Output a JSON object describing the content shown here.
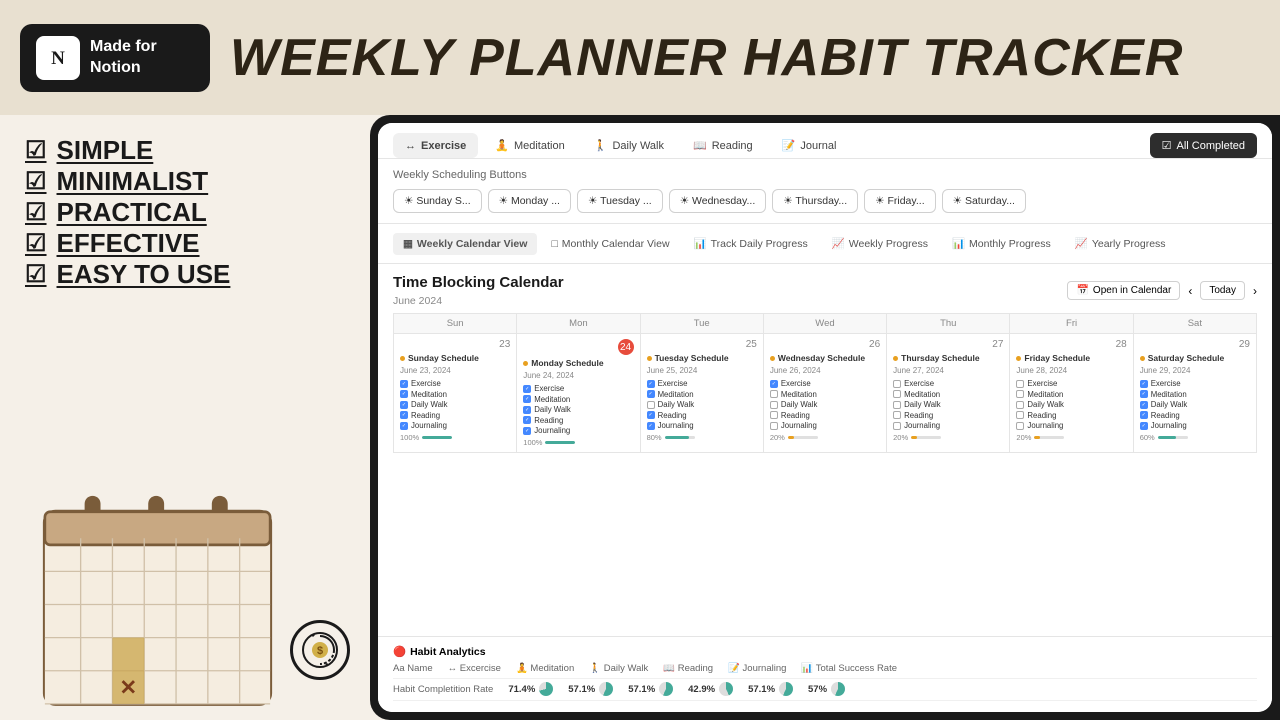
{
  "header": {
    "notion_badge_line1": "Made for",
    "notion_badge_line2": "Notion",
    "title": "WEEKLY PLANNER HABIT TRACKER"
  },
  "features": [
    "SIMPLE",
    "MINIMALIST",
    "PRACTICAL",
    "EFFECTIVE",
    "EASY TO USE"
  ],
  "notion_app": {
    "habit_tabs": [
      {
        "icon": "↔",
        "label": "Exercise",
        "active": true
      },
      {
        "icon": "🧘",
        "label": "Meditation",
        "active": false
      },
      {
        "icon": "🚶",
        "label": "Daily Walk",
        "active": false
      },
      {
        "icon": "📖",
        "label": "Reading",
        "active": false
      },
      {
        "icon": "📝",
        "label": "Journal",
        "active": false
      },
      {
        "icon": "☑",
        "label": "All Completed",
        "active": false,
        "special": true
      }
    ],
    "weekly_buttons_label": "Weekly Scheduling Buttons",
    "day_buttons": [
      "☀ Sunday S...",
      "☀ Monday ...",
      "☀ Tuesday ...",
      "☀ Wednesday...",
      "☀ Thursday...",
      "☀ Friday...",
      "☀ Saturday..."
    ],
    "calendar_nav_tabs": [
      {
        "icon": "▦",
        "label": "Weekly Calendar View",
        "active": true
      },
      {
        "icon": "□",
        "label": "Monthly Calendar View",
        "active": false
      },
      {
        "icon": "📊",
        "label": "Track Daily Progress",
        "active": false
      },
      {
        "icon": "📈",
        "label": "Weekly Progress",
        "active": false
      },
      {
        "icon": "📊",
        "label": "Monthly Progress",
        "active": false
      },
      {
        "icon": "📈",
        "label": "Yearly Progress",
        "active": false
      }
    ],
    "calendar_title": "Time Blocking Calendar",
    "calendar_month": "June 2024",
    "open_calendar_btn": "Open in Calendar",
    "today_btn": "Today",
    "day_headers": [
      "Sun",
      "Mon",
      "Tue",
      "Wed",
      "Thu",
      "Fri",
      "Sat"
    ],
    "calendar_days": [
      {
        "date": "23",
        "today": false,
        "event_title": "Sunday Schedule",
        "event_date": "June 23, 2024",
        "tasks": [
          {
            "label": "Exercise",
            "checked": true
          },
          {
            "label": "Meditation",
            "checked": true
          },
          {
            "label": "Daily Walk",
            "checked": true
          },
          {
            "label": "Reading",
            "checked": true
          },
          {
            "label": "Journaling",
            "checked": true
          }
        ],
        "progress": 100
      },
      {
        "date": "24",
        "today": true,
        "event_title": "Monday Schedule",
        "event_date": "June 24, 2024",
        "tasks": [
          {
            "label": "Exercise",
            "checked": true
          },
          {
            "label": "Meditation",
            "checked": true
          },
          {
            "label": "Daily Walk",
            "checked": true
          },
          {
            "label": "Reading",
            "checked": true
          },
          {
            "label": "Journaling",
            "checked": true
          }
        ],
        "progress": 100
      },
      {
        "date": "25",
        "today": false,
        "event_title": "Tuesday Schedule",
        "event_date": "June 25, 2024",
        "tasks": [
          {
            "label": "Exercise",
            "checked": true
          },
          {
            "label": "Meditation",
            "checked": true
          },
          {
            "label": "Daily Walk",
            "checked": false
          },
          {
            "label": "Reading",
            "checked": true
          },
          {
            "label": "Journaling",
            "checked": true
          }
        ],
        "progress": 80
      },
      {
        "date": "26",
        "today": false,
        "event_title": "Wednesday Schedule",
        "event_date": "June 26, 2024",
        "tasks": [
          {
            "label": "Exercise",
            "checked": true
          },
          {
            "label": "Meditation",
            "checked": false
          },
          {
            "label": "Daily Walk",
            "checked": false
          },
          {
            "label": "Reading",
            "checked": false
          },
          {
            "label": "Journaling",
            "checked": false
          }
        ],
        "progress": 20
      },
      {
        "date": "27",
        "today": false,
        "event_title": "Thursday Schedule",
        "event_date": "June 27, 2024",
        "tasks": [
          {
            "label": "Exercise",
            "checked": false
          },
          {
            "label": "Meditation",
            "checked": false
          },
          {
            "label": "Daily Walk",
            "checked": false
          },
          {
            "label": "Reading",
            "checked": false
          },
          {
            "label": "Journaling",
            "checked": false
          }
        ],
        "progress": 20
      },
      {
        "date": "28",
        "today": false,
        "event_title": "Friday Schedule",
        "event_date": "June 28, 2024",
        "tasks": [
          {
            "label": "Exercise",
            "checked": false
          },
          {
            "label": "Meditation",
            "checked": false
          },
          {
            "label": "Daily Walk",
            "checked": false
          },
          {
            "label": "Reading",
            "checked": false
          },
          {
            "label": "Journaling",
            "checked": false
          }
        ],
        "progress": 20
      },
      {
        "date": "29",
        "today": false,
        "event_title": "Saturday Schedule",
        "event_date": "June 29, 2024",
        "tasks": [
          {
            "label": "Exercise",
            "checked": true
          },
          {
            "label": "Meditation",
            "checked": true
          },
          {
            "label": "Daily Walk",
            "checked": true
          },
          {
            "label": "Reading",
            "checked": true
          },
          {
            "label": "Journaling",
            "checked": true
          }
        ],
        "progress": 60
      }
    ],
    "analytics": {
      "title": "Habit Analytics",
      "columns": [
        "Aa Name",
        "↔ Excercise",
        "🧘 Meditation",
        "🚶 Daily Walk",
        "📖 Reading",
        "📝 Journaling",
        "📊 Total Success Rate"
      ],
      "row_label": "Habit Completition Rate",
      "values": [
        {
          "label": "71.4%",
          "pct": 71
        },
        {
          "label": "57.1%",
          "pct": 57
        },
        {
          "label": "57.1%",
          "pct": 57
        },
        {
          "label": "42.9%",
          "pct": 43
        },
        {
          "label": "57.1%",
          "pct": 57
        },
        {
          "label": "57%",
          "pct": 57
        }
      ]
    }
  }
}
